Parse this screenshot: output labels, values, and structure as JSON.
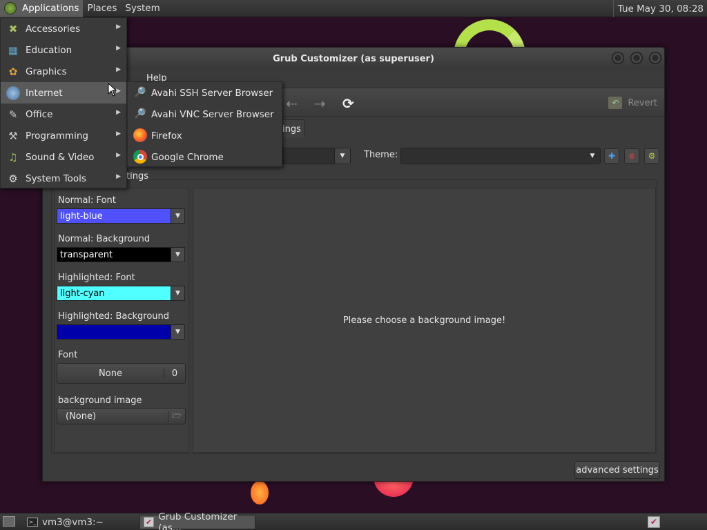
{
  "topbar": {
    "menus": [
      "Applications",
      "Places",
      "System"
    ],
    "clock": "Tue May 30, 08:28"
  },
  "window": {
    "title": "Grub Customizer (as superuser)",
    "menu_help": "Help",
    "revert_label": "Revert",
    "tab_label": "ings",
    "theme_label": "Theme:",
    "theme_value": "",
    "settings_legend": "tings",
    "normal_font_label": "Normal: Font",
    "normal_font_value": "light-blue",
    "normal_bg_label": "Normal: Background",
    "normal_bg_value": "transparent",
    "hl_font_label": "Highlighted: Font",
    "hl_font_value": "light-cyan",
    "hl_bg_label": "Highlighted: Background",
    "hl_bg_value": "blue",
    "font_label": "Font",
    "font_value": "None",
    "font_size": "0",
    "bg_image_label": "background image",
    "bg_image_value": "(None)",
    "preview_text": "Please choose a background image!",
    "advanced_label": "advanced settings"
  },
  "app_menu": {
    "items": [
      {
        "label": "Accessories",
        "icon": "accessories-icon"
      },
      {
        "label": "Education",
        "icon": "education-icon"
      },
      {
        "label": "Graphics",
        "icon": "graphics-icon"
      },
      {
        "label": "Internet",
        "icon": "internet-icon"
      },
      {
        "label": "Office",
        "icon": "office-icon"
      },
      {
        "label": "Programming",
        "icon": "programming-icon"
      },
      {
        "label": "Sound & Video",
        "icon": "sound-video-icon"
      },
      {
        "label": "System Tools",
        "icon": "system-tools-icon"
      }
    ],
    "highlighted": "Internet"
  },
  "internet_submenu": {
    "items": [
      {
        "label": "Avahi SSH Server Browser",
        "icon": "avahi-icon"
      },
      {
        "label": "Avahi VNC Server Browser",
        "icon": "avahi-icon"
      },
      {
        "label": "Firefox",
        "icon": "firefox-icon"
      },
      {
        "label": "Google Chrome",
        "icon": "chrome-icon"
      }
    ]
  },
  "taskbar": {
    "tasks": [
      "vm3@vm3:~",
      "Grub Customizer (as..."
    ]
  },
  "colors": {
    "light_blue": "#5050ff",
    "light_cyan": "#50ffff",
    "blue": "#0000aa",
    "transparent_bg": "#000000",
    "desktop": "#2a0e24"
  }
}
